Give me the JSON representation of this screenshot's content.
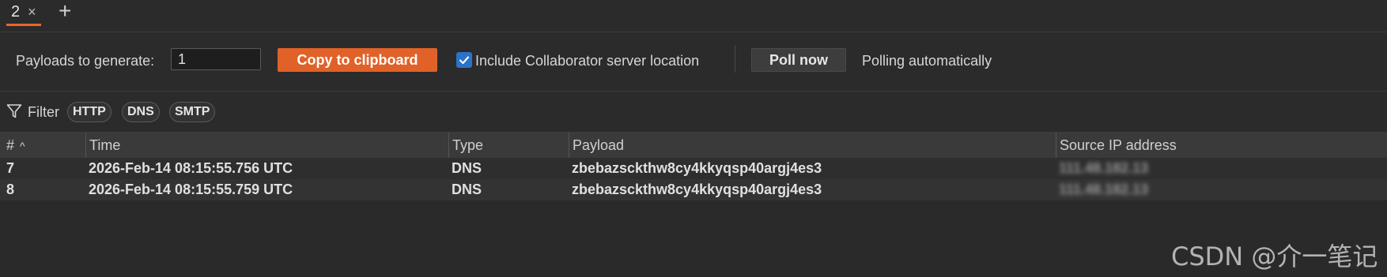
{
  "tabs": [
    {
      "label": "2",
      "close_icon": "×"
    }
  ],
  "add_tab_icon": "+",
  "toolbar": {
    "payloads_label": "Payloads to generate:",
    "payloads_value": "1",
    "copy_button": "Copy to clipboard",
    "include_location_label": "Include Collaborator server location",
    "include_location_checked": true,
    "poll_button": "Poll now",
    "polling_status": "Polling automatically"
  },
  "filter": {
    "label": "Filter",
    "chips": [
      "HTTP",
      "DNS",
      "SMTP"
    ]
  },
  "table": {
    "columns": [
      "#",
      "Time",
      "Type",
      "Payload",
      "Source IP address"
    ],
    "sort_indicator": "^",
    "rows": [
      {
        "num": "7",
        "time": "2026-Feb-14 08:15:55.756 UTC",
        "type": "DNS",
        "payload": "zbebazsckthw8cy4kkyqsp40argj4es3",
        "source_ip": "111.48.182.13"
      },
      {
        "num": "8",
        "time": "2026-Feb-14 08:15:55.759 UTC",
        "type": "DNS",
        "payload": "zbebazsckthw8cy4kkyqsp40argj4es3",
        "source_ip": "111.48.182.13"
      }
    ]
  },
  "watermark": "CSDN @介一笔记",
  "colors": {
    "accent": "#e06228",
    "checkbox": "#2a73c9",
    "background": "#2b2b2b",
    "header": "#3a3a3a"
  }
}
